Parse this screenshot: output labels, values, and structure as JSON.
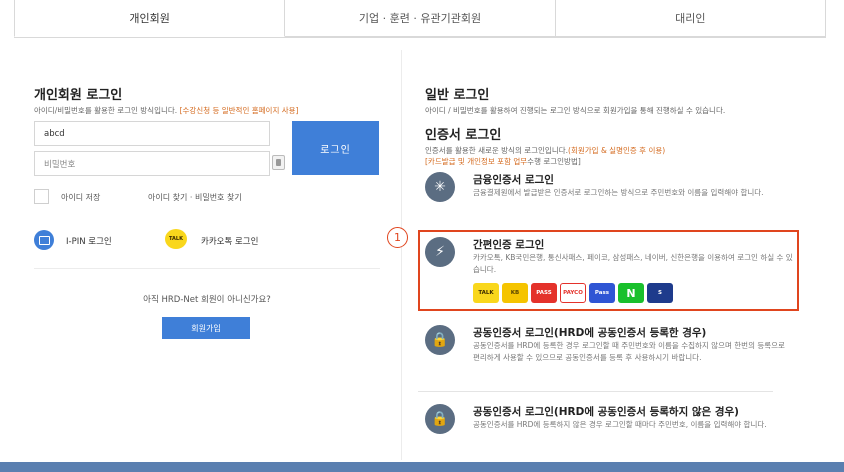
{
  "tabs": [
    {
      "label": "개인회원"
    },
    {
      "label": "기업 · 훈련 · 유관기관회원"
    },
    {
      "label": "대리인"
    }
  ],
  "personal_login": {
    "title": "개인회원 로그인",
    "desc": "아이디/비밀번호를 활용한 로그인 방식입니다.",
    "desc_highlight": "[수강신청 등 일반적인 홈페이지 사용]",
    "id_value": "abcd",
    "pw_placeholder": "비밀번호",
    "login_button": "로그인",
    "save_id": "아이디 저장",
    "find_links": "아이디 찾기 · 비밀번호 찾기",
    "ipin": "I-PIN 로그인",
    "kakao_icon": "TALK",
    "kakao": "카카오톡 로그인",
    "join_question": "아직 HRD-Net 회원이 아니신가요?",
    "join_button": "회원가입"
  },
  "general_login": {
    "title": "일반 로그인",
    "desc": "아이디 / 비밀번호를 활용하여 진행되는 로그인 방식으로 회원가입을 통해 진행하실 수 있습니다."
  },
  "cert_login": {
    "title": "인증서 로그인",
    "desc_line1": "인증서를 활용한 새로운 방식의 로그인입니다.",
    "desc_line1_hl": "(회원가입 & 실명인증 후 이용)",
    "desc_line2_hl": "[카드발급 및 개인정보 포함 업무",
    "desc_line2": "수행 로그인방법]"
  },
  "methods": [
    {
      "icon": "asterisk-icon",
      "title": "금융인증서 로그인",
      "desc": "금융결제원에서 발급받은 인증서로 로그인하는 방식으로 주민번호와 이름을 입력해야 합니다."
    },
    {
      "icon": "bolt-icon",
      "title": "간편인증 로그인",
      "desc": "카카오톡, KB국민은행, 통신사패스, 페이코, 삼성패스, 네이버, 신한은행을 이용하여 로그인 하실 수 있습니다."
    },
    {
      "icon": "lock-plus-icon",
      "title": "공동인증서 로그인(HRD에 공동인증서 등록한 경우)",
      "desc": "공동인증서를 HRD에 등록한 경우 로그인할 때 주민번호와 이름을 수집하지 않으며 한번의 등록으로 편리하게 사용할 수 있으므로 공동인증서를 등록 후 사용하시기 바랍니다."
    },
    {
      "icon": "lock-icon",
      "title": "공동인증서 로그인(HRD에 공동인증서 등록하지 않은 경우)",
      "desc": "공동인증서를 HRD에 등록하지 않은 경우 로그인할 때마다 주민번호, 이름을 입력해야 합니다."
    }
  ],
  "callout_number": "1",
  "provider_logos": [
    "TALK",
    "KB",
    "PASS",
    "PAYCO",
    "Pass",
    "N",
    "S"
  ],
  "colors": {
    "primary": "#3f7fd8",
    "highlight": "#e0451e",
    "accent_text": "#d46a1e"
  }
}
